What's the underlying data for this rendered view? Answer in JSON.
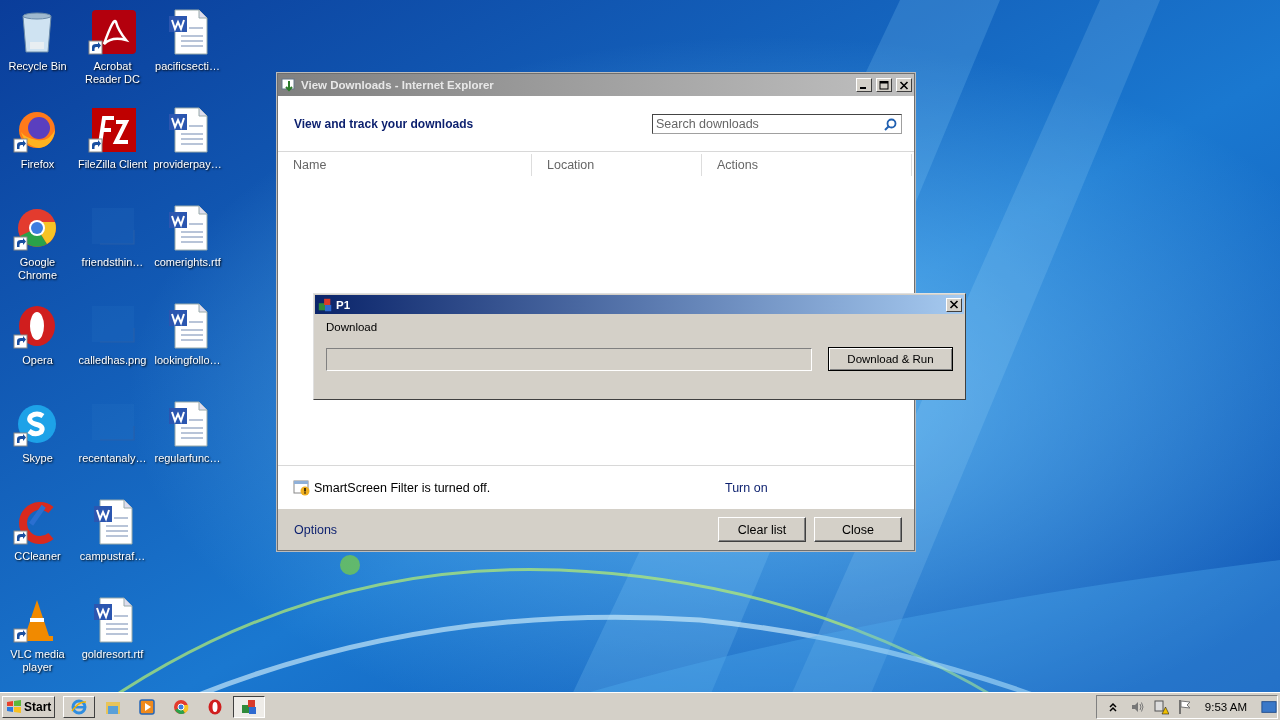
{
  "desktop": {
    "columns": [
      [
        {
          "label": "Recycle Bin",
          "kind": "recycle",
          "shortcut": false
        },
        {
          "label": "Firefox",
          "kind": "firefox",
          "shortcut": true
        },
        {
          "label": "Google\nChrome",
          "kind": "chrome",
          "shortcut": true
        },
        {
          "label": "Opera",
          "kind": "opera",
          "shortcut": true
        },
        {
          "label": "Skype",
          "kind": "skype",
          "shortcut": true
        },
        {
          "label": "CCleaner",
          "kind": "ccleaner",
          "shortcut": true
        },
        {
          "label": "VLC media\nplayer",
          "kind": "vlc",
          "shortcut": true
        }
      ],
      [
        {
          "label": "Acrobat\nReader DC",
          "kind": "acrobat",
          "shortcut": true
        },
        {
          "label": "FileZilla Client",
          "kind": "filezilla",
          "shortcut": true
        },
        {
          "label": "friendsthin…",
          "kind": "blank",
          "shortcut": false
        },
        {
          "label": "calledhas.png",
          "kind": "blank",
          "shortcut": false
        },
        {
          "label": "recentanaly…",
          "kind": "blank",
          "shortcut": false
        },
        {
          "label": "campustraf…",
          "kind": "word",
          "shortcut": false
        },
        {
          "label": "goldresort.rtf",
          "kind": "word",
          "shortcut": false
        }
      ],
      [
        {
          "label": "pacificsecti…",
          "kind": "word",
          "shortcut": false
        },
        {
          "label": "providerpay…",
          "kind": "word",
          "shortcut": false
        },
        {
          "label": "comerights.rtf",
          "kind": "word",
          "shortcut": false
        },
        {
          "label": "lookingfollo…",
          "kind": "word",
          "shortcut": false
        },
        {
          "label": "regularfunc…",
          "kind": "word",
          "shortcut": false
        }
      ]
    ]
  },
  "downloads_window": {
    "title": "View Downloads - Internet Explorer",
    "heading": "View and track your downloads",
    "search": {
      "placeholder": "Search downloads"
    },
    "columns": [
      "Name",
      "Location",
      "Actions"
    ],
    "smartscreen": {
      "message": "SmartScreen Filter is turned off.",
      "link": "Turn on"
    },
    "options_link": "Options",
    "buttons": [
      "Clear list",
      "Close"
    ]
  },
  "dialog": {
    "title": "P1",
    "label": "Download",
    "progress": {
      "level": 0
    },
    "button": "Download & Run"
  },
  "taskbar": {
    "start": "Start",
    "items": [
      {
        "kind": "ie",
        "running": true,
        "selected": false
      },
      {
        "kind": "folder",
        "running": false,
        "selected": false
      },
      {
        "kind": "media",
        "running": false,
        "selected": false
      },
      {
        "kind": "chrome",
        "running": false,
        "selected": false
      },
      {
        "kind": "opera",
        "running": false,
        "selected": false
      },
      {
        "kind": "app",
        "running": true,
        "selected": true
      }
    ],
    "clock": "9:53 AM"
  }
}
